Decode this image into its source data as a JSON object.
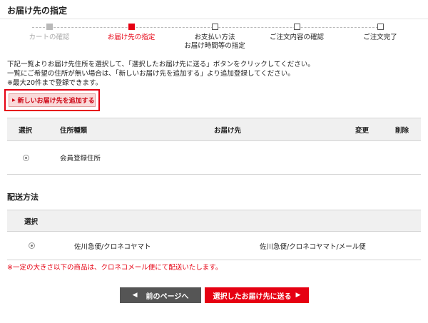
{
  "page": {
    "title": "お届け先の指定"
  },
  "steps": [
    {
      "label": "カートの確認",
      "label2": "",
      "state": "done"
    },
    {
      "label": "お届け先の指定",
      "label2": "",
      "state": "current"
    },
    {
      "label": "お支払い方法",
      "label2": "お届け時間等の指定",
      "state": "todo"
    },
    {
      "label": "ご注文内容の確認",
      "label2": "",
      "state": "todo"
    },
    {
      "label": "ご注文完了",
      "label2": "",
      "state": "todo"
    }
  ],
  "instructions": {
    "line1": "下記一覧よりお届け先住所を選択して、「選択したお届け先に送る」ボタンをクリックしてください。",
    "line2": "一覧にご希望の住所が無い場合は、「新しいお届け先を追加する」より追加登録してください。",
    "line3": "※最大20件まで登録できます。"
  },
  "add_button": {
    "label": "新しいお届け先を追加する"
  },
  "address_table": {
    "headers": {
      "select": "選択",
      "type": "住所種類",
      "destination": "お届け先",
      "change": "変更",
      "delete": "削除"
    },
    "rows": [
      {
        "type": "会員登録住所",
        "destination": "",
        "selected": true
      }
    ]
  },
  "shipping": {
    "title": "配送方法",
    "header_select": "選択",
    "row": {
      "method": "佐川急便/クロネコヤマト",
      "alt_method": "佐川急便/クロネコヤマト/メール便",
      "selected": true
    }
  },
  "note": "※一定の大きさ以下の商品は、クロネコメール便にて配送いたします。",
  "buttons": {
    "prev": "前のページへ",
    "next": "選択したお届け先に送る"
  },
  "colors": {
    "accent": "#e60012",
    "dark_button": "#555555",
    "header_bg": "#f0f0f0"
  },
  "icons": {
    "prev": "triangle-left-icon",
    "next": "triangle-right-icon",
    "add": "triangle-right-icon"
  }
}
